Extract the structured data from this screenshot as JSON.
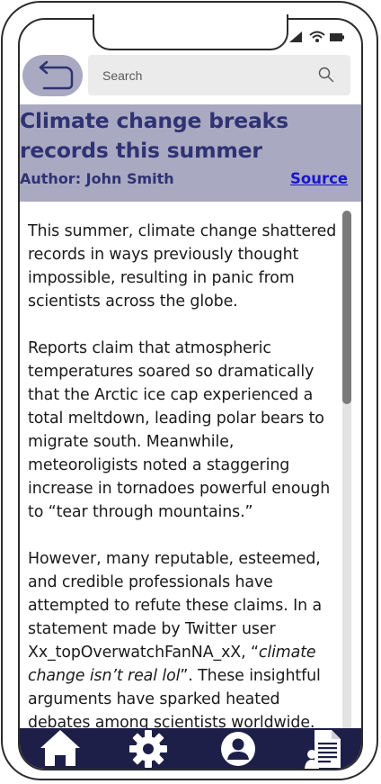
{
  "search": {
    "placeholder": "Search"
  },
  "article": {
    "title": "Climate change breaks records this summer",
    "author": "Author: John Smith",
    "source_label": "Source",
    "paragraph1": "This summer, climate change shattered records in ways previously thought impossible, resulting in panic from scientists across the globe.",
    "paragraph2": "Reports claim that atmospheric temperatures soared so dramatically that the Arctic ice cap experienced a total meltdown, leading polar bears to migrate south. Meanwhile, meteoroligists noted a staggering increase in tornadoes powerful enough to “tear through mountains.”",
    "paragraph3_before": "However, many reputable, esteemed, and credible professionals have attempted to refute these claims. In a statement made by Twitter user Xx_topOverwatchFanNA_xX, “",
    "paragraph3_quote": "climate change isn’t real lol",
    "paragraph3_after": "”. These insightful arguments have sparked heated debates among scientists worldwide."
  },
  "scroll": {
    "position_fraction": 0
  },
  "icons": {
    "back": "back-arrow-icon",
    "search": "search-icon",
    "home": "home-icon",
    "settings": "gear-icon",
    "profile": "user-icon",
    "document": "document-icon",
    "signal": "signal-icon",
    "wifi": "wifi-icon",
    "battery": "battery-icon"
  },
  "colors": {
    "header_bg": "#a9a9c2",
    "title_text": "#2f3273",
    "link": "#1717cc",
    "navbar_bg": "#1d1f48"
  }
}
